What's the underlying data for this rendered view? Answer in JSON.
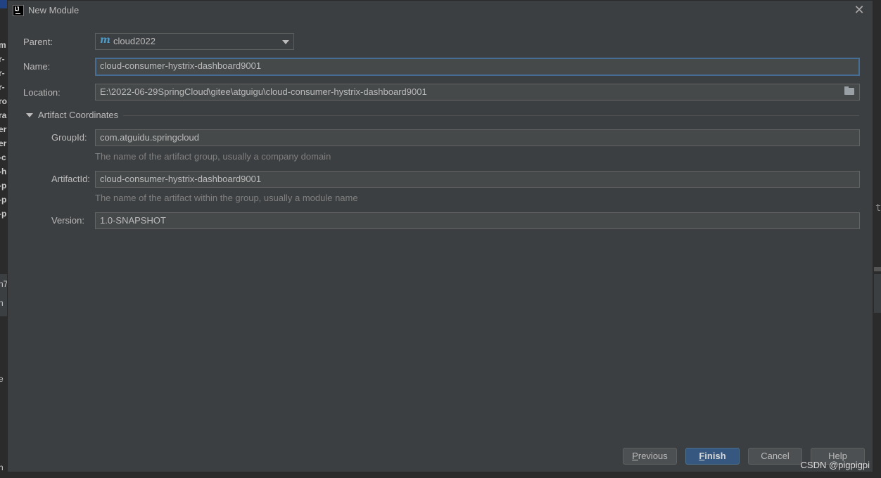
{
  "window": {
    "title": "New Module",
    "icon": "intellij-icon",
    "icon_text": "IJ"
  },
  "background_fragments": {
    "left": [
      "m",
      "r-",
      "r-",
      "r-",
      "ro",
      "ra",
      "er",
      "er",
      "-c",
      "-h",
      "-p",
      "-p",
      "-p",
      "n7",
      "n",
      "e",
      "n"
    ],
    "right": "t"
  },
  "form": {
    "parent": {
      "label": "Parent:",
      "value": "cloud2022",
      "icon": "maven-icon",
      "icon_glyph": "m"
    },
    "name": {
      "label": "Name:",
      "value": "cloud-consumer-hystrix-dashboard9001"
    },
    "location": {
      "label": "Location:",
      "value": "E:\\2022-06-29SpringCloud\\gitee\\atguigu\\cloud-consumer-hystrix-dashboard9001",
      "icon": "folder-icon"
    },
    "artifact_section": {
      "label": "Artifact Coordinates",
      "expanded": true
    },
    "group_id": {
      "label": "GroupId:",
      "value": "com.atguidu.springcloud",
      "hint": "The name of the artifact group, usually a company domain"
    },
    "artifact_id": {
      "label": "ArtifactId:",
      "value": "cloud-consumer-hystrix-dashboard9001",
      "hint": "The name of the artifact within the group, usually a module name"
    },
    "version": {
      "label": "Version:",
      "value": "1.0-SNAPSHOT"
    }
  },
  "buttons": {
    "previous": {
      "mnemonic": "P",
      "rest": "revious"
    },
    "finish": {
      "mnemonic": "F",
      "rest": "inish"
    },
    "cancel": "Cancel",
    "help": "Help"
  },
  "watermark": "CSDN @pigpigpi",
  "colors": {
    "dialog_bg": "#3c3f41",
    "field_bg": "#45494a",
    "focus_border": "#466d94",
    "primary_button": "#365880",
    "hint_text": "#808080",
    "maven_icon": "#4d9bc9"
  }
}
